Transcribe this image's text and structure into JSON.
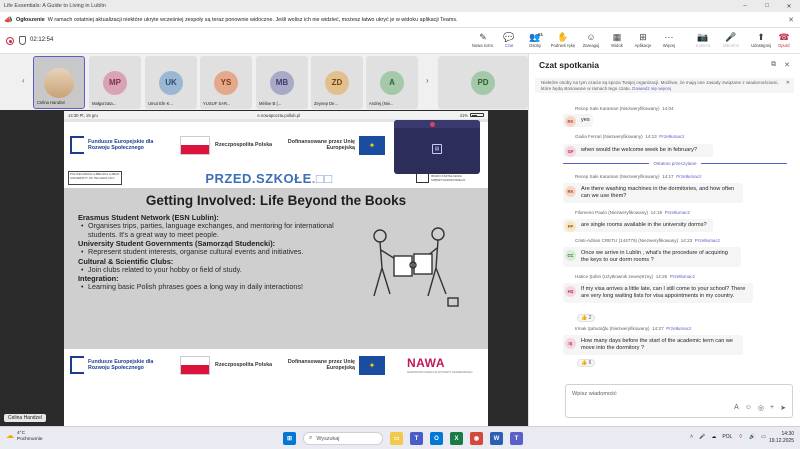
{
  "window": {
    "title": "Life Essentials: A Guide to Living in Lublin"
  },
  "announcement": {
    "label": "Ogłoszenie",
    "text": "W ramach ostatniej aktualizacji niektóre ukryte wcześniej zespoły są teraz ponownie widoczne. Jeśli wolisz ich nie widzieć, możesz łatwo ukryć je w widoku aplikacji Teams."
  },
  "meeting": {
    "timer": "02:12:54"
  },
  "toolbar": {
    "new_message": "Nowa rozm.",
    "chat": "Czat",
    "people": "Osoby",
    "people_count": "61",
    "raise_hand": "Podnieś rękę",
    "react": "Zareaguj",
    "view": "Widok",
    "apps": "Aplikacje",
    "more": "Więcej",
    "camera": "Kamera",
    "mic": "Mikrofon",
    "share": "Udostępnij",
    "leave": "Opuść"
  },
  "participants": [
    {
      "initials": "",
      "name": "Celina Handzel",
      "color": "#caa277"
    },
    {
      "initials": "MP",
      "name": "Małgorzata...",
      "color": "#d9a3b5"
    },
    {
      "initials": "UK",
      "name": "Umut Efe K...",
      "color": "#9bb7d4"
    },
    {
      "initials": "YS",
      "name": "YUSUF SAR...",
      "color": "#e3a98a"
    },
    {
      "initials": "MB",
      "name": "Méline B (...",
      "color": "#a9a9c8"
    },
    {
      "initials": "ZD",
      "name": "Zeynep De...",
      "color": "#e2c08d"
    },
    {
      "initials": "A",
      "name": "Andrej (Nie...",
      "color": "#a3c9a8"
    },
    {
      "initials": "PD",
      "name": "",
      "color": "#a3c9a8"
    }
  ],
  "phone": {
    "time": "14:30 Pt, 19 gru",
    "url": "e.nowapoczta.pollub.pl",
    "battery": "41%"
  },
  "slide_logos": {
    "eu_funds": "Fundusze Europejskie dla Rozwoju Społecznego",
    "poland": "Rzeczpospolita Polska",
    "eu_cofunded": "Dofinansowane przez Unię Europejską",
    "lublin_tech": "POLITECHNIKA LUBELSKA LUBLIN UNIVERSITY OF TECHNOLOGY",
    "project": "PRZED.SZKOŁE",
    "bkm": "BIURO KSZTAŁCENIA MIĘDZYNARODOWEGO",
    "nawa": "NAWA",
    "nawa_sub": "NARODOWA AGENCJA WYMIANY AKADEMICKIEJ"
  },
  "slide": {
    "title": "Getting Involved: Life Beyond the Books",
    "sections": [
      {
        "heading": "Erasmus Student Network (ESN Lublin):",
        "bullet": "Organises trips, parties, language exchanges, and mentoring for international students. It's a great way to meet people."
      },
      {
        "heading": "University Student Governments (Samorząd Studencki):",
        "bullet": "Represent student interests, organise cultural events and initiatives."
      },
      {
        "heading": "Cultural & Scientific Clubs:",
        "bullet": "Join clubs related to your hobby or field of study."
      },
      {
        "heading": "Integration:",
        "bullet": "Learning basic Polish phrases goes a long way in daily interactions!"
      }
    ]
  },
  "self_name": "Celina Handzel",
  "chat": {
    "title": "Czat spotkania",
    "notice": "Niektóre osoby na tym czacie są spoza Twojej organizacji. Możliwe, że mają one zasady związane z wiadomościami, które będą stosowane w ramach tego czatu.",
    "notice_link": "Dowiedz się więcej",
    "last_read": "Ostatnio przeczytane",
    "messages": [
      {
        "sender": "Recep Saki Karaman (Niezweryfikowany)",
        "time": "14:04",
        "initials": "RK",
        "text": "yes",
        "translate": "",
        "reaction": ""
      },
      {
        "sender": "Giulia Ferrari (Niezweryfikowany)",
        "time": "14:13",
        "initials": "GF",
        "text": "when would the welcome week be in february?",
        "translate": "Przetłumacz",
        "reaction": ""
      },
      {
        "sender": "Recep Saki Karaman (Niezweryfikowany)",
        "time": "14:17",
        "initials": "RK",
        "text": "Are there washing machines in the dormitories, and how often can we use them?",
        "translate": "Przetłumacz",
        "reaction": ""
      },
      {
        "sender": "Filomeno Paulo (Niezweryfikowany)",
        "time": "14:19",
        "initials": "FP",
        "text": "are single rooms available in the university dorms?",
        "translate": "Przetłumacz",
        "reaction": ""
      },
      {
        "sender": "Cristi-Adrian CRETU (144775) (Niezweryfikowany)",
        "time": "14:23",
        "initials": "CC",
        "text": "Once we arrive in Lublin , what's the procedure of acquiring the keys to our dorm rooms ?",
        "translate": "Przetłumacz",
        "reaction": ""
      },
      {
        "sender": "Hatice Şahin (Użytkownik zewnętrzny)",
        "time": "14:26",
        "initials": "HŞ",
        "text": "If my visa arrives a little late, can I still come to your school? There are very long waiting lists for visa appointments in my country.",
        "translate": "Przetłumacz",
        "reaction": "2"
      },
      {
        "sender": "Irmak Şahutoğlu (Niezweryfikowany)",
        "time": "14:27",
        "initials": "IŞ",
        "text": "How many days before the start of the academic term can we move into the dormitory ?",
        "translate": "Przetłumacz",
        "reaction": "6"
      }
    ],
    "compose_placeholder": "Wpisz wiadomość"
  },
  "taskbar": {
    "temp": "4°C",
    "weather": "Pochmurnie",
    "search": "Wyszukaj",
    "lang": "POL",
    "time": "14:30",
    "date": "19.12.2025"
  }
}
